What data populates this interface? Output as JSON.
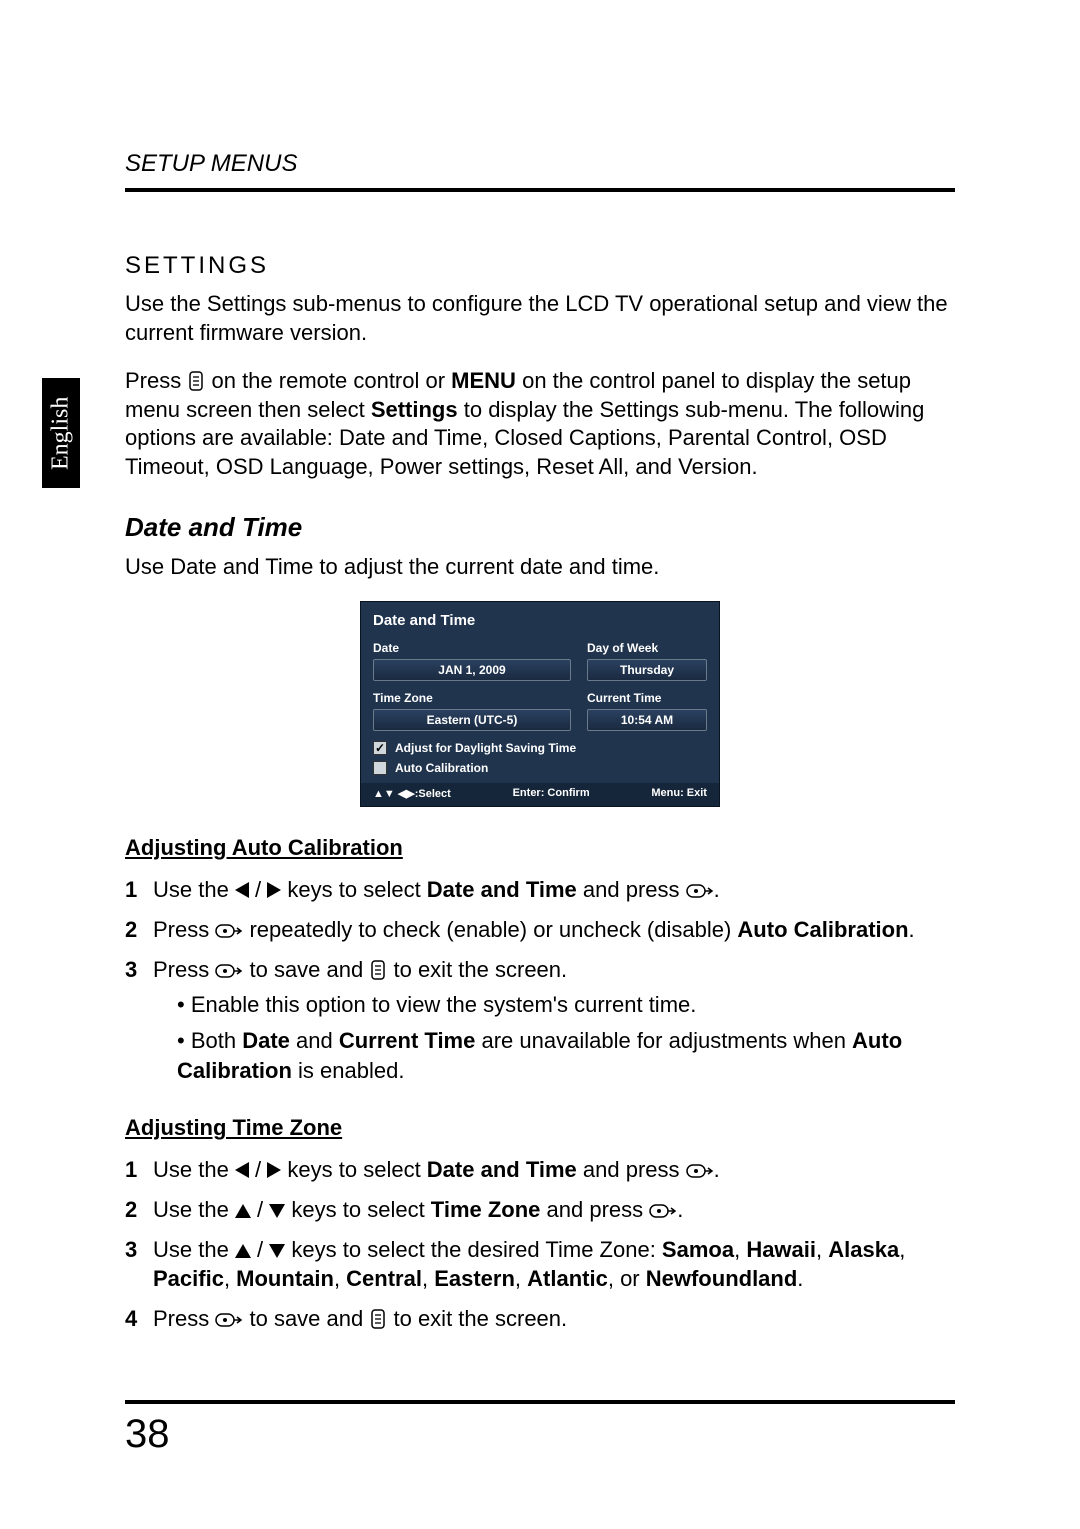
{
  "header": {
    "title": "SETUP MENUS"
  },
  "side_tab": "English",
  "settings": {
    "heading": "SETTINGS",
    "intro": "Use the Settings sub-menus to configure the LCD TV operational setup and view the current firmware version.",
    "press_text_1": "Press ",
    "press_text_2": " on the remote control or ",
    "menu_word": "MENU",
    "press_text_3": " on the control panel to display the setup menu screen then select ",
    "settings_word": "Settings",
    "press_text_4": " to display the Settings sub-menu. The following options are available: Date and Time, Closed Captions, Parental Control, OSD Timeout, OSD Language, Power settings, Reset All, and Version."
  },
  "date_time": {
    "heading": "Date and Time",
    "intro": "Use Date and Time to adjust the current date and time."
  },
  "osd": {
    "title": "Date and Time",
    "date_label": "Date",
    "date_value": "JAN 1, 2009",
    "dow_label": "Day of Week",
    "dow_value": "Thursday",
    "tz_label": "Time Zone",
    "tz_value": "Eastern (UTC-5)",
    "ct_label": "Current Time",
    "ct_value": "10:54 AM",
    "dst_label": "Adjust for Daylight Saving Time",
    "ac_label": "Auto Calibration",
    "footer_select": "▲▼ ◀▶:Select",
    "footer_confirm": "Enter: Confirm",
    "footer_exit": "Menu: Exit"
  },
  "auto_cal": {
    "heading": "Adjusting Auto Calibration",
    "s1a": "Use the ",
    "s1b": " keys to select ",
    "s1_target": "Date and Time",
    "s1c": " and press ",
    "s2a": "Press ",
    "s2b": " repeatedly to check (enable) or uncheck (disable) ",
    "s2_target": "Auto Calibration",
    "s3a": "Press ",
    "s3b": " to save and ",
    "s3c": " to exit the screen.",
    "b1": "Enable this option to view the system's current time.",
    "b2a": "Both ",
    "b2_date": "Date",
    "b2b": " and ",
    "b2_ct": "Current Time",
    "b2c": " are unavailable for adjustments when ",
    "b2_ac": "Auto Calibration",
    "b2d": " is enabled."
  },
  "time_zone": {
    "heading": "Adjusting Time Zone",
    "s1a": "Use the ",
    "s1b": " keys to select ",
    "s1_target": "Date and Time",
    "s1c": " and press ",
    "s2a": "Use the ",
    "s2b": " keys to select ",
    "s2_target": "Time Zone",
    "s2c": " and press ",
    "s3a": "Use the ",
    "s3b": " keys to select the desired Time Zone: ",
    "s3_list1": "Samoa",
    "s3_list2": "Hawaii",
    "s3_list3": "Alaska",
    "s3_list4": "Pacific",
    "s3_list5": "Mountain",
    "s3_list6": "Central",
    "s3_list7": "Eastern",
    "s3_list8": "Atlantic",
    "s3_or": ", or ",
    "s3_list9": "Newfoundland",
    "s4a": "Press ",
    "s4b": " to save and ",
    "s4c": " to exit the screen."
  },
  "page_number": "38"
}
